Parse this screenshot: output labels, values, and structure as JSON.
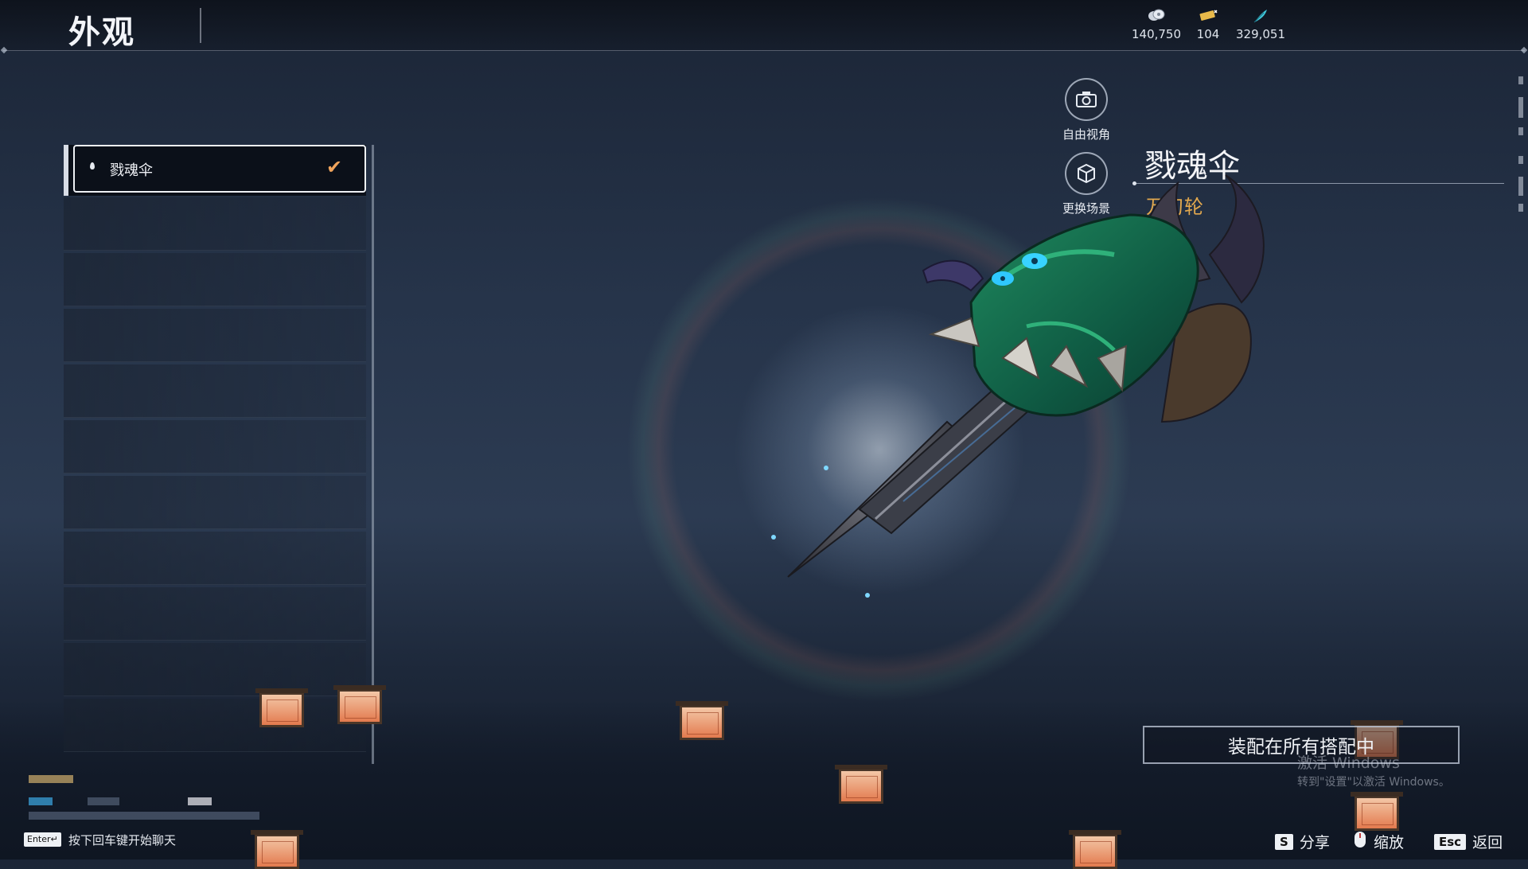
{
  "header": {
    "title": "外观",
    "currencies": [
      {
        "icon": "coin-stack-icon",
        "value": "140,750"
      },
      {
        "icon": "gold-ticket-icon",
        "value": "104"
      },
      {
        "icon": "feather-icon",
        "value": "329,051"
      }
    ]
  },
  "list": {
    "items": [
      {
        "label": "戮魂伞",
        "selected": true,
        "equipped": true
      }
    ]
  },
  "camera": {
    "free_view_label": "自由视角",
    "change_scene_label": "更换场景"
  },
  "weapon": {
    "name": "戮魂伞",
    "type": "万刃轮"
  },
  "actions": {
    "equip_all_label": "装配在所有搭配中"
  },
  "watermark": {
    "line1": "激活 Windows",
    "line2": "转到\"设置\"以激活 Windows。"
  },
  "chat": {
    "enter_key": "Enter↵",
    "hint": "按下回车键开始聊天"
  },
  "footer_hints": [
    {
      "key": "S",
      "label": "分享"
    },
    {
      "key": "",
      "label": "缩放",
      "icon": "mouse-icon"
    },
    {
      "key": "Esc",
      "label": "返回"
    }
  ],
  "colors": {
    "accent_orange": "#f0a45c",
    "weapon_type_gold": "#e2a84e"
  }
}
